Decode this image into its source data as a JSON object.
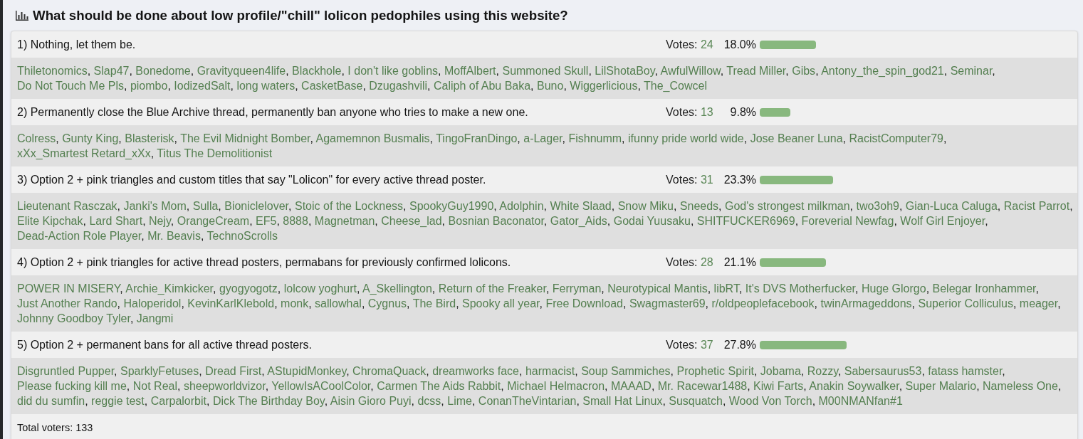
{
  "poll": {
    "title": "What should be done about low profile/\"chill\" lolicon pedophiles using this website?",
    "options": [
      {
        "label": "1) Nothing, let them be.",
        "votes_label": "Votes:",
        "votes": "24",
        "percent": "18.0%",
        "level": 0.18,
        "voters": {
          "separator": ",",
          "names": [
            "Thiletonomics",
            "Slap47",
            "Bonedome",
            "Gravityqueen4life",
            "Blackhole",
            "I don't like goblins",
            "MoffAlbert",
            "Summoned Skull",
            "LilShotaBoy",
            "AwfulWillow",
            "Tread Miller",
            "Gibs",
            "Antony_the_spin_god21",
            "Seminar",
            "Do Not Touch Me Pls",
            "piombo",
            "IodizedSalt",
            "long waters",
            "CasketBase",
            "Dzugashvili",
            "Caliph of Abu Baka",
            "Buno",
            "Wiggerlicious",
            "The_Cowcel"
          ]
        }
      },
      {
        "label": "2) Permanently close the Blue Archive thread, permanently ban anyone who tries to make a new one.",
        "votes_label": "Votes:",
        "votes": "13",
        "percent": "9.8%",
        "level": 0.098,
        "voters": {
          "separator": ",",
          "names": [
            "Colress",
            "Gunty King",
            "Blasterisk",
            "The Evil Midnight Bomber",
            "Agamemnon Busmalis",
            "TingoFranDingo",
            "a-Lager",
            "Fishnumm",
            "ifunny pride world wide",
            "Jose Beaner Luna",
            "RacistComputer79",
            "xXx_Smartest Retard_xXx",
            "Titus The Demolitionist"
          ]
        }
      },
      {
        "label": "3) Option 2 + pink triangles and custom titles that say \"Lolicon\" for every active thread poster.",
        "votes_label": "Votes:",
        "votes": "31",
        "percent": "23.3%",
        "level": 0.233,
        "voters": {
          "separator": ",",
          "names": [
            "Lieutenant Rasczak",
            "Janki's Mom",
            "Sulla",
            "Bioniclelover",
            "Stoic of the Lockness",
            "SpookyGuy1990",
            "Adolphin",
            "White Slaad",
            "Snow Miku",
            "Sneeds",
            "God's strongest milkman",
            "two3oh9",
            "Gian-Luca Caluga",
            "Racist Parrot",
            "Elite Kipchak",
            "Lard Shart",
            "Nejy",
            "OrangeCream",
            "EF5",
            "8888",
            "Magnetman",
            "Cheese_lad",
            "Bosnian Baconator",
            "Gator_Aids",
            "Godai Yuusaku",
            "SHITFUCKER6969",
            "Foreverial Newfag",
            "Wolf Girl Enjoyer",
            "Dead-Action Role Player",
            "Mr. Beavis",
            "TechnoScrolls"
          ]
        }
      },
      {
        "label": "4) Option 2 + pink triangles for active thread posters, permabans for previously confirmed lolicons.",
        "votes_label": "Votes:",
        "votes": "28",
        "percent": "21.1%",
        "level": 0.211,
        "voters": {
          "separator": ",",
          "names": [
            "POWER IN MISERY",
            "Archie_Kimkicker",
            "gyogyogotz",
            "lolcow yoghurt",
            "A_Skellington",
            "Return of the Freaker",
            "Ferryman",
            "Neurotypical Mantis",
            "libRT",
            "It's DVS Motherfucker",
            "Huge Glorgo",
            "Belegar Ironhammer",
            "Just Another Rando",
            "Haloperidol",
            "KevinKarlKlebold",
            "monk",
            "sallowhal",
            "Cygnus",
            "The Bird",
            "Spooky all year",
            "Free Download",
            "Swagmaster69",
            "r/oldpeoplefacebook",
            "twinArmageddons",
            "Superior Colliculus",
            "meager",
            "Johnny Goodboy Tyler",
            "Jangmi"
          ]
        }
      },
      {
        "label": "5) Option 2 + permanent bans for all active thread posters.",
        "votes_label": "Votes:",
        "votes": "37",
        "percent": "27.8%",
        "level": 0.278,
        "voters": {
          "separator": ",",
          "names": [
            "Disgruntled Pupper",
            "SparklyFetuses",
            "Dread First",
            "AStupidMonkey",
            "ChromaQuack",
            "dreamworks face",
            "harmacist",
            "Soup Sammiches",
            "Prophetic Spirit",
            "Jobama",
            "Rozzy",
            "Sabersaurus53",
            "fatass hamster",
            "Please fucking kill me",
            "Not Real",
            "sheepworldvizor",
            "YellowIsACoolColor",
            "Carmen The Aids Rabbit",
            "Michael Helmacron",
            "MAAAD",
            "Mr. Racewar1488",
            "Kiwi Farts",
            "Anakin Soywalker",
            "Super Malario",
            "Nameless One",
            "did du sumfin",
            "reggie test",
            "Carpalorbit",
            "Dick The Birthday Boy",
            "Aisin Gioro Puyi",
            "dcss",
            "Lime",
            "ConanTheVintarian",
            "Small Hat Linux",
            "Susquatch",
            "Wood Von Torch",
            "M00NMANfan#1"
          ]
        }
      }
    ],
    "total": "Total voters: 133"
  }
}
